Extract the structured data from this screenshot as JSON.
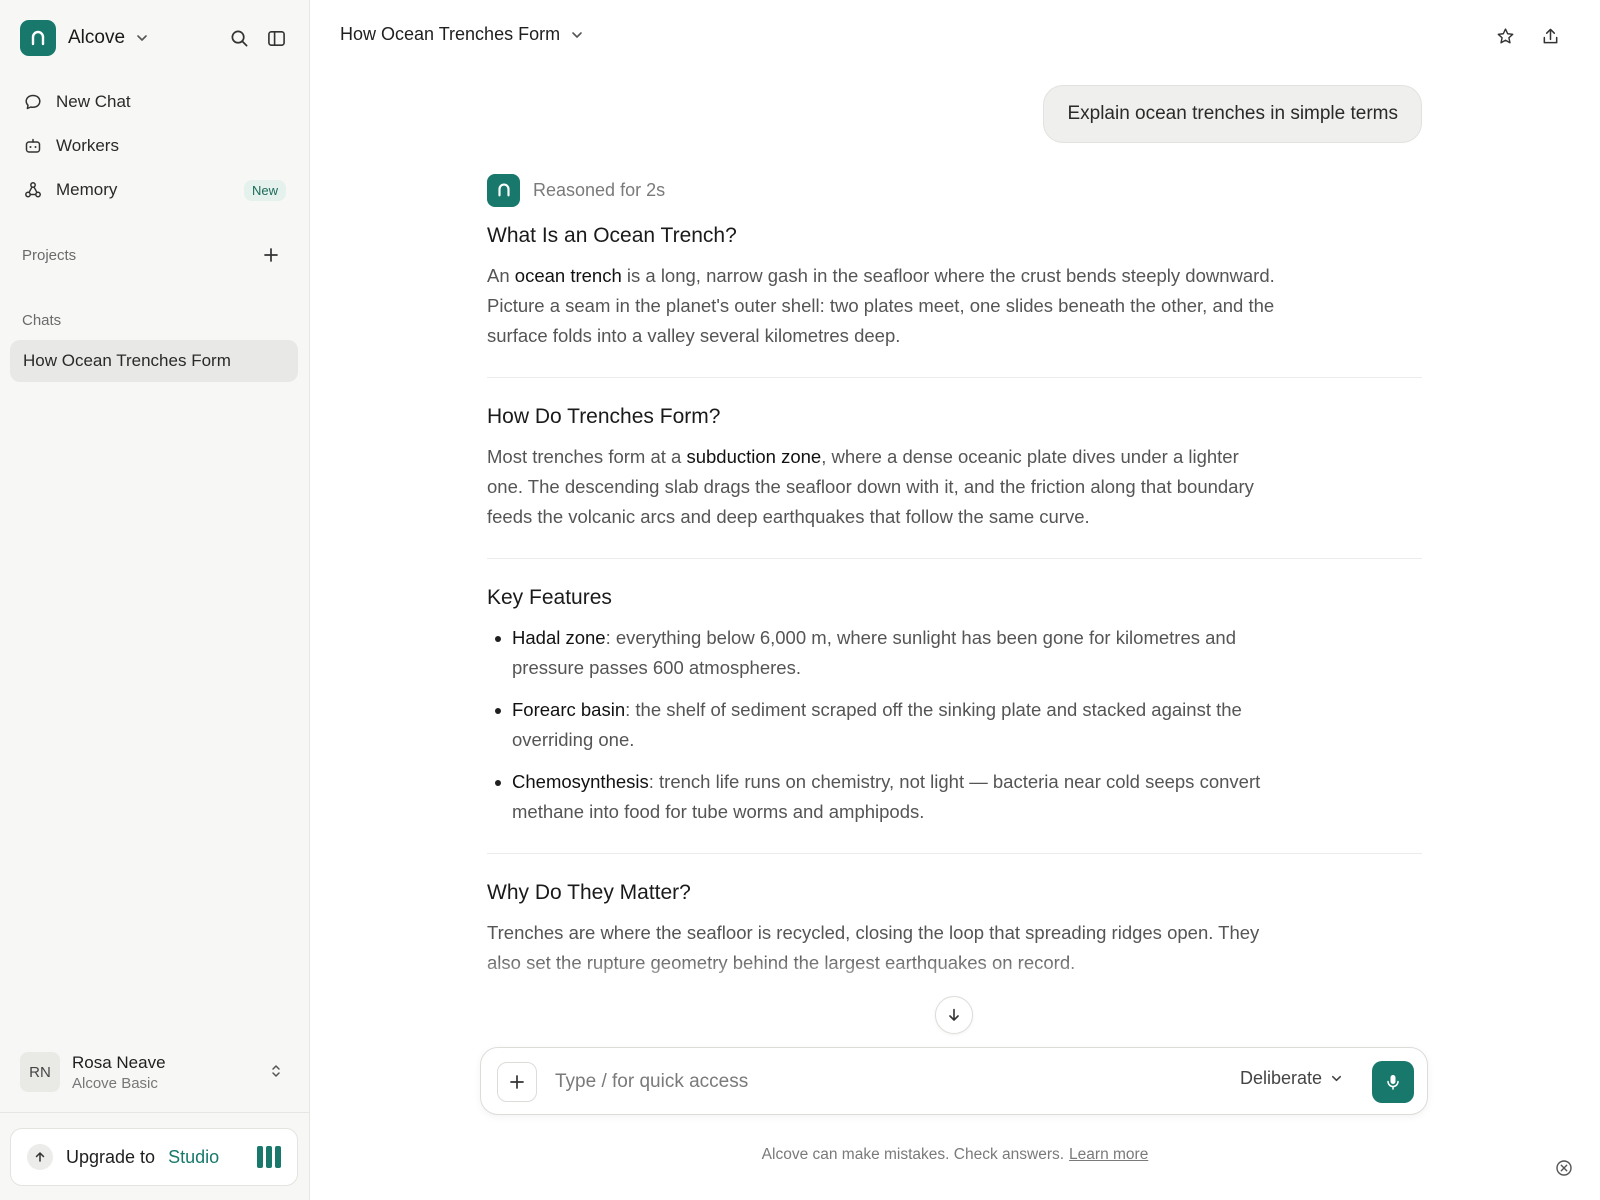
{
  "sidebar": {
    "brand_name": "Alcove",
    "nav": [
      {
        "label": "New Chat",
        "icon": "chat-bubble-icon"
      },
      {
        "label": "Workers",
        "icon": "robot-icon"
      },
      {
        "label": "Memory",
        "icon": "memory-graph-icon",
        "badge": "New"
      }
    ],
    "projects_label": "Projects",
    "chats_label": "Chats",
    "chats": [
      "How Ocean Trenches Form"
    ],
    "user": {
      "initials": "RN",
      "name": "Rosa Neave",
      "plan": "Alcove Basic"
    },
    "upgrade": {
      "text": "Upgrade to",
      "tier": "Studio"
    }
  },
  "header": {
    "title": "How Ocean Trenches Form"
  },
  "conversation": {
    "user_message": "Explain ocean trenches in simple terms",
    "reasoned": "Reasoned for 2s",
    "sections": [
      {
        "heading": "What Is an Ocean Trench?",
        "p_pre": "An ",
        "p_bold": "ocean trench",
        "p_post": " is a long, narrow gash in the seafloor where the crust bends steeply downward. Picture a seam in the planet's outer shell: two plates meet, one slides beneath the other, and the surface folds into a valley several kilometres deep."
      },
      {
        "heading": "How Do Trenches Form?",
        "p_pre": "Most trenches form at a ",
        "p_bold": "subduction zone",
        "p_post": ", where a dense oceanic plate dives under a lighter one. The descending slab drags the seafloor down with it, and the friction along that boundary feeds the volcanic arcs and deep earthquakes that follow the same curve."
      },
      {
        "heading": "Key Features",
        "bullets": [
          {
            "term": "Hadal zone",
            "text": ": everything below 6,000 m, where sunlight has been gone for kilometres and pressure passes 600 atmospheres."
          },
          {
            "term": "Forearc basin",
            "text": ": the shelf of sediment scraped off the sinking plate and stacked against the overriding one."
          },
          {
            "term": "Chemosynthesis",
            "text": ": trench life runs on chemistry, not light — bacteria near cold seeps convert methane into food for tube worms and amphipods."
          }
        ]
      },
      {
        "heading": "Why Do They Matter?",
        "p": "Trenches are where the seafloor is recycled, closing the loop that spreading ridges open. They also set the rupture geometry behind the largest earthquakes on record."
      }
    ]
  },
  "composer": {
    "placeholder": "Type / for quick access",
    "mode": "Deliberate"
  },
  "footer": {
    "disclaimer": "Alcove can make mistakes. Check answers.",
    "learn_more": "Learn more"
  },
  "colors": {
    "accent": "#17786b",
    "sidebar_bg": "#f7f7f5",
    "badge_bg": "#e4f1ec"
  }
}
